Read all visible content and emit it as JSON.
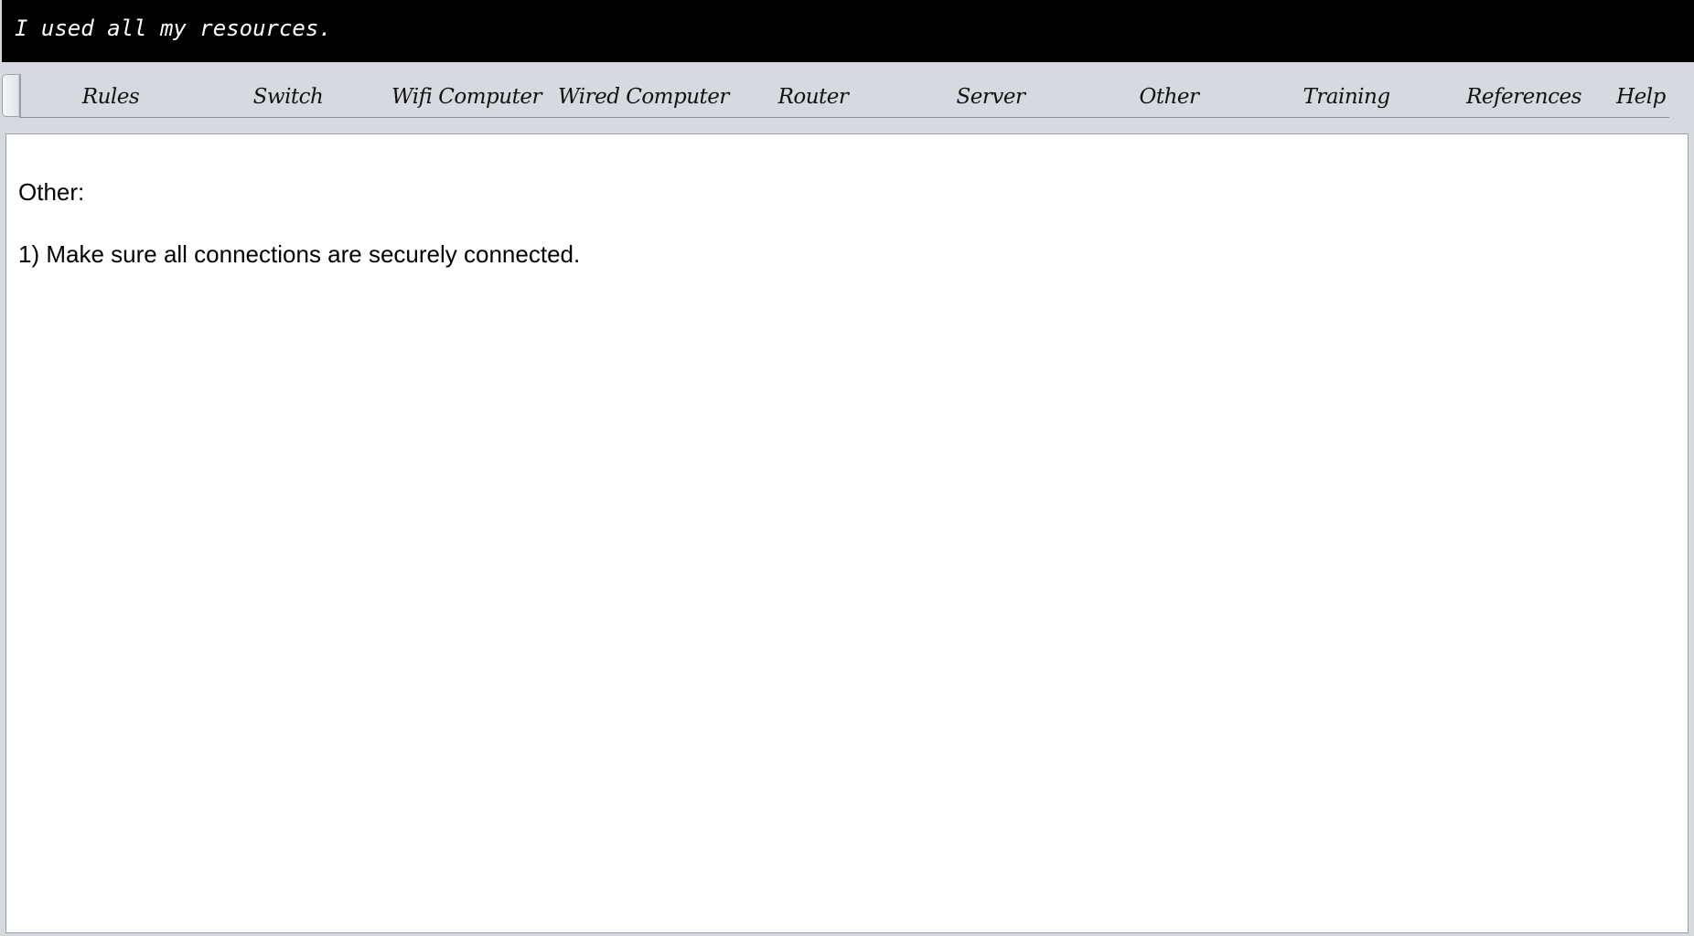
{
  "title_bar": {
    "text": "I used all my resources."
  },
  "tabs": [
    {
      "label": "Rules"
    },
    {
      "label": "Switch"
    },
    {
      "label": "Wifi Computer"
    },
    {
      "label": "Wired Computer"
    },
    {
      "label": "Router"
    },
    {
      "label": "Server"
    },
    {
      "label": "Other"
    },
    {
      "label": "Training"
    },
    {
      "label": "References"
    },
    {
      "label": "Help"
    }
  ],
  "content": {
    "section_title": "Other:",
    "items": [
      {
        "text": "1) Make sure all connections are securely connected."
      }
    ]
  },
  "colors": {
    "title_bar_bg": "#000000",
    "title_text": "#ffffff",
    "page_bg": "#d6d9df",
    "content_bg": "#ffffff"
  }
}
